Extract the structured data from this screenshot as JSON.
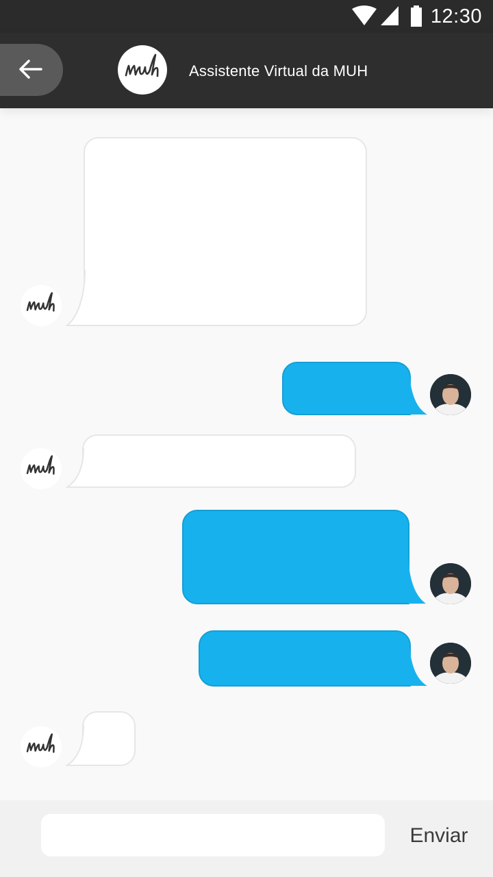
{
  "status_bar": {
    "time": "12:30"
  },
  "header": {
    "title": "Assistente Virtual da MUH",
    "logo_text": "muh"
  },
  "messages": [
    {
      "sender": "bot",
      "text": ""
    },
    {
      "sender": "user",
      "text": ""
    },
    {
      "sender": "bot",
      "text": ""
    },
    {
      "sender": "user",
      "text": ""
    },
    {
      "sender": "user",
      "text": ""
    },
    {
      "sender": "bot",
      "text": ""
    }
  ],
  "composer": {
    "send_label": "Enviar",
    "value": ""
  },
  "colors": {
    "user_bubble": "#17b2ee",
    "app_bar": "#2e2e2e",
    "bot_bubble": "#ffffff"
  }
}
